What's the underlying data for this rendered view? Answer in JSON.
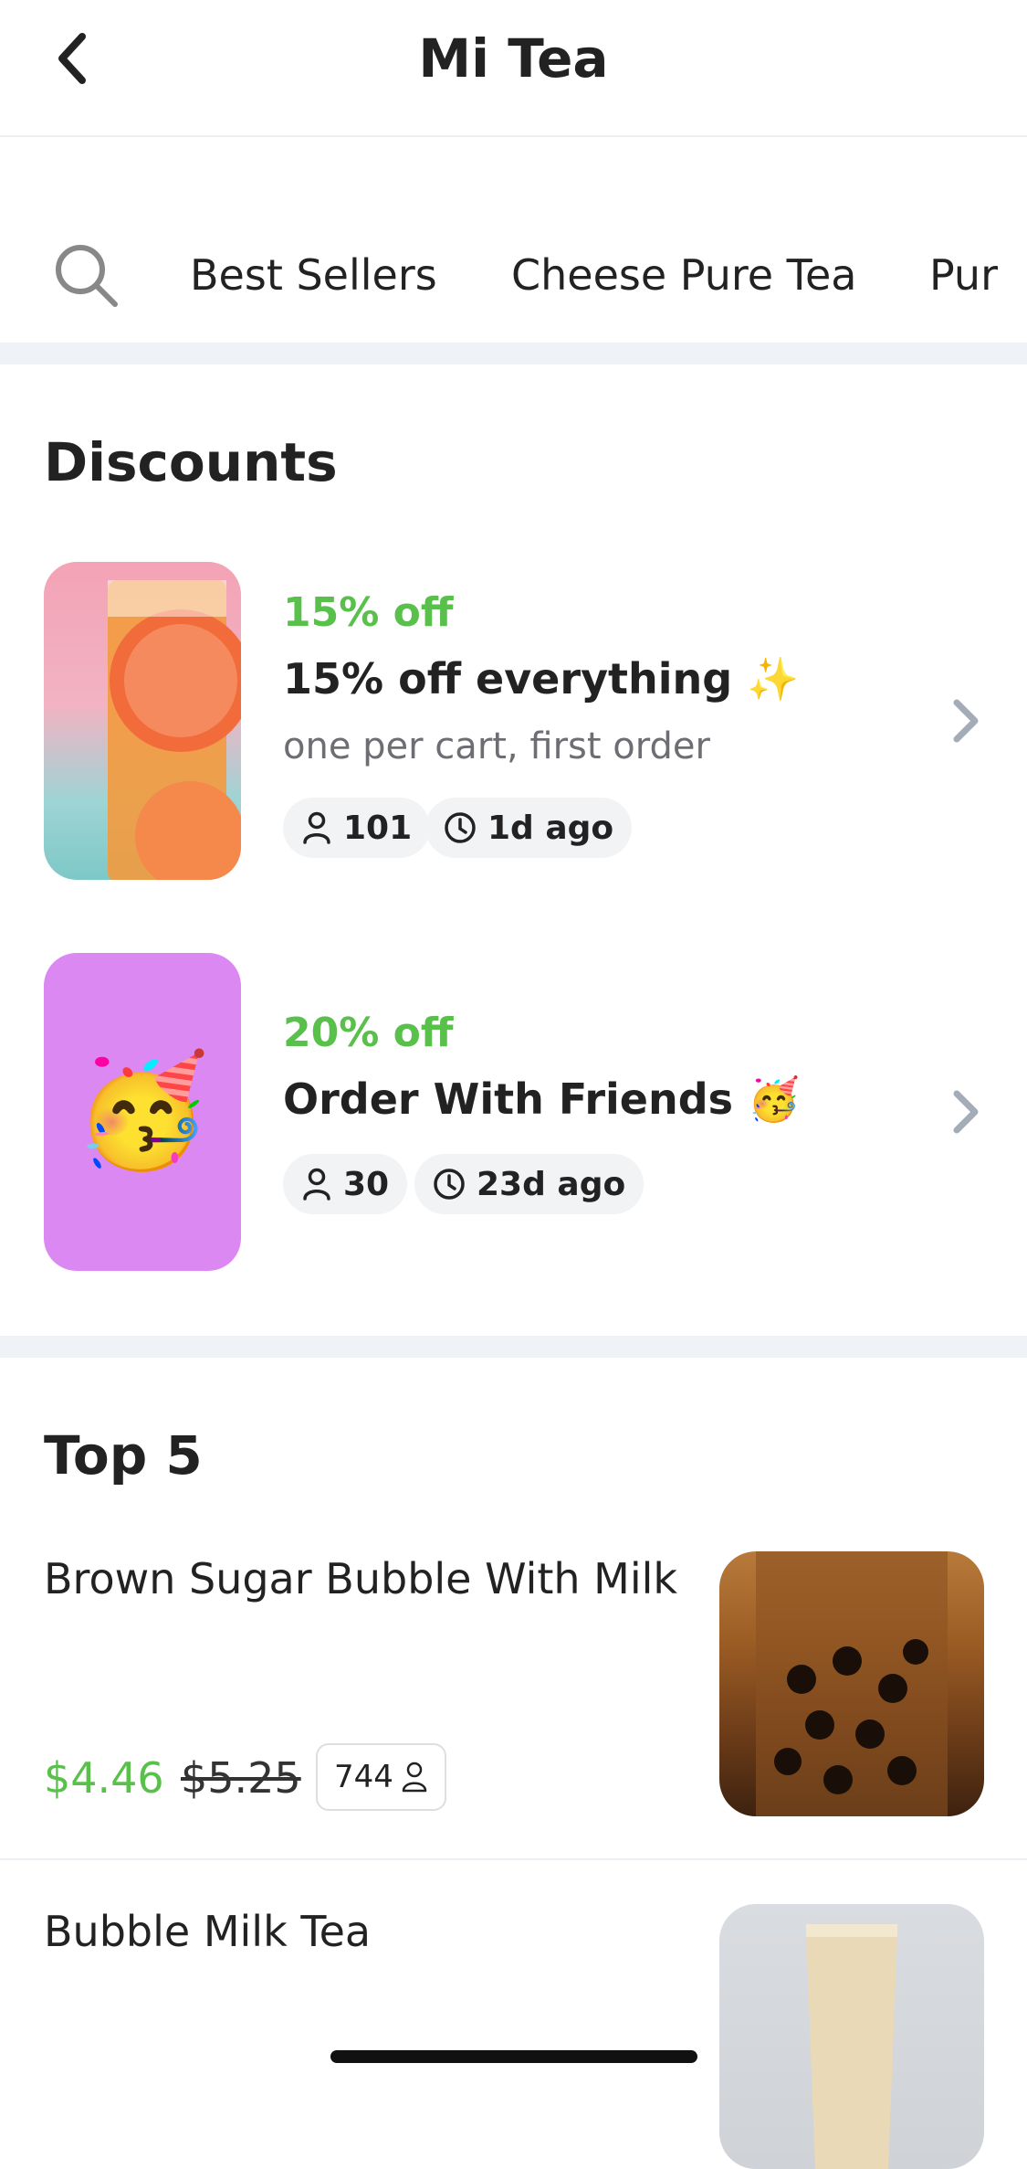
{
  "header": {
    "title": "Mi Tea"
  },
  "tabs": [
    {
      "label": "Best Sellers"
    },
    {
      "label": "Cheese Pure Tea"
    },
    {
      "label": "Pur"
    }
  ],
  "discounts_section": {
    "title": "Discounts",
    "items": [
      {
        "label": "15% off",
        "title": "15% off everything ✨",
        "subtitle": "one per cart, first order",
        "users": "101",
        "age": "1d ago"
      },
      {
        "label": "20% off",
        "title": "Order With Friends 🥳",
        "users": "30",
        "age": "23d ago",
        "emoji": "🥳"
      }
    ]
  },
  "top5_section": {
    "title": "Top 5",
    "items": [
      {
        "name": "Brown Sugar Bubble With Milk",
        "price": "$4.46",
        "old_price": "$5.25",
        "count": "744"
      },
      {
        "name": "Bubble Milk Tea"
      }
    ]
  },
  "colors": {
    "accent_green": "#5ac04c",
    "party_purple": "#dc88f2",
    "separator": "#eff2f7"
  },
  "icons": [
    "back-chevron-icon",
    "search-icon",
    "person-icon",
    "clock-icon",
    "chevron-right-icon"
  ]
}
